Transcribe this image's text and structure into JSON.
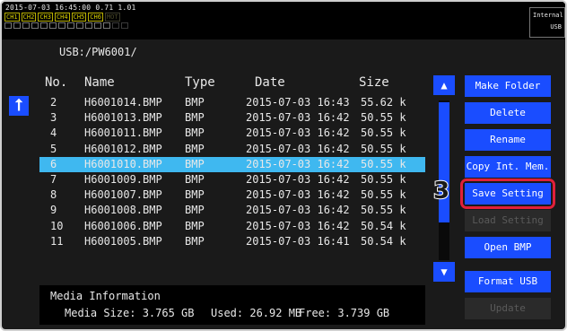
{
  "status": {
    "datetime": "2015-07-03 16:45:00 0.71 1.01",
    "channels": [
      "CH1",
      "CH2",
      "CH3",
      "CH4",
      "CH5",
      "CH6",
      "MOT"
    ],
    "storage_line1": "Internal",
    "storage_line2": "USB"
  },
  "path": "USB:/PW6001/",
  "table": {
    "headers": {
      "no": "No.",
      "name": "Name",
      "type": "Type",
      "date": "Date",
      "size": "Size"
    },
    "rows": [
      {
        "no": "2",
        "name": "H6001014.BMP",
        "type": "BMP",
        "date": "2015-07-03 16:43",
        "size": "55.62 k"
      },
      {
        "no": "3",
        "name": "H6001013.BMP",
        "type": "BMP",
        "date": "2015-07-03 16:42",
        "size": "50.55 k"
      },
      {
        "no": "4",
        "name": "H6001011.BMP",
        "type": "BMP",
        "date": "2015-07-03 16:42",
        "size": "50.55 k"
      },
      {
        "no": "5",
        "name": "H6001012.BMP",
        "type": "BMP",
        "date": "2015-07-03 16:42",
        "size": "50.55 k"
      },
      {
        "no": "6",
        "name": "H6001010.BMP",
        "type": "BMP",
        "date": "2015-07-03 16:42",
        "size": "50.55 k"
      },
      {
        "no": "7",
        "name": "H6001009.BMP",
        "type": "BMP",
        "date": "2015-07-03 16:42",
        "size": "50.55 k"
      },
      {
        "no": "8",
        "name": "H6001007.BMP",
        "type": "BMP",
        "date": "2015-07-03 16:42",
        "size": "50.55 k"
      },
      {
        "no": "9",
        "name": "H6001008.BMP",
        "type": "BMP",
        "date": "2015-07-03 16:42",
        "size": "50.55 k"
      },
      {
        "no": "10",
        "name": "H6001006.BMP",
        "type": "BMP",
        "date": "2015-07-03 16:42",
        "size": "50.54 k"
      },
      {
        "no": "11",
        "name": "H6001005.BMP",
        "type": "BMP",
        "date": "2015-07-03 16:41",
        "size": "50.54 k"
      }
    ],
    "selected_no": "6"
  },
  "buttons": {
    "make_folder": "Make Folder",
    "delete": "Delete",
    "rename": "Rename",
    "copy_int_mem": "Copy Int. Mem.",
    "save_setting": "Save Setting",
    "load_setting": "Load Setting",
    "open_bmp": "Open BMP",
    "format_usb": "Format USB",
    "update": "Update"
  },
  "annotation": {
    "step": "3"
  },
  "media": {
    "title": "Media Information",
    "size": "Media Size:  3.765 GB",
    "used": "Used: 26.92 MB",
    "free": "Free: 3.739 GB"
  },
  "colors": {
    "accent": "#1a4dff",
    "selected_row": "#3fb8f0",
    "highlight": "#e0203a"
  },
  "icons": {
    "up_folder": "up-arrow-icon",
    "scroll_up": "triangle-up-icon",
    "scroll_down": "triangle-down-icon"
  }
}
